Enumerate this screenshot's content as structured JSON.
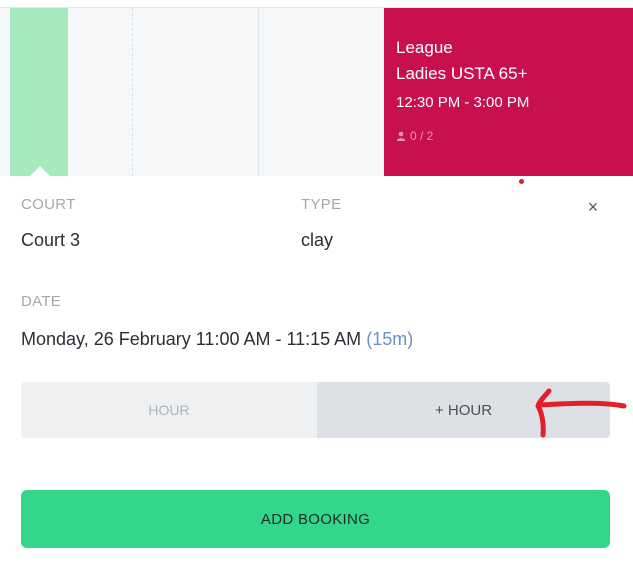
{
  "event": {
    "category": "League",
    "title": "Ladies USTA 65+",
    "time": "12:30 PM - 3:00 PM",
    "capacity": "0 / 2"
  },
  "details": {
    "court_label": "COURT",
    "court_value": "Court 3",
    "type_label": "TYPE",
    "type_value": "clay",
    "date_label": "DATE",
    "date_value": "Monday, 26 February  11:00 AM - 11:15 AM",
    "duration": "(15m)"
  },
  "close_icon": "×",
  "hour_toggle": {
    "minus_label": "HOUR",
    "plus_label": "+ HOUR"
  },
  "add_booking_label": "ADD BOOKING",
  "colors": {
    "event": "#c8104f",
    "available_slot": "#a6e9bf",
    "primary_button": "#33d78b",
    "annotation": "#e0202a"
  },
  "icons": {
    "capacity": "person-icon",
    "close": "close-icon"
  }
}
